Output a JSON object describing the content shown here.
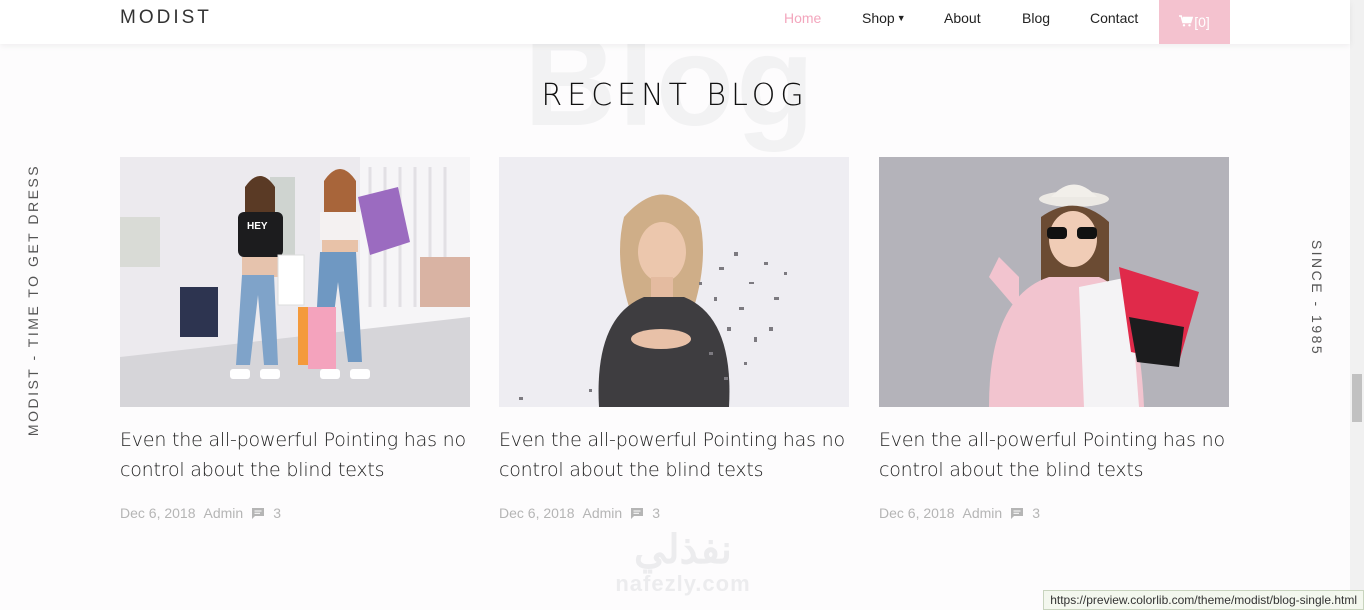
{
  "brand": "MODIST",
  "nav": {
    "home": "Home",
    "shop": "Shop",
    "about": "About",
    "blog": "Blog",
    "contact": "Contact",
    "cart": "[0]"
  },
  "section": {
    "bg_word": "Blog",
    "title": "RECENT BLOG"
  },
  "side": {
    "left": "MODIST - TIME TO GET DRESS",
    "right": "SINCE - 1985"
  },
  "posts": [
    {
      "title": "Even the all-powerful Pointing has no control about the blind texts",
      "date": "Dec 6, 2018",
      "author": "Admin",
      "comments": "3"
    },
    {
      "title": "Even the all-powerful Pointing has no control about the blind texts",
      "date": "Dec 6, 2018",
      "author": "Admin",
      "comments": "3"
    },
    {
      "title": "Even the all-powerful Pointing has no control about the blind texts",
      "date": "Dec 6, 2018",
      "author": "Admin",
      "comments": "3"
    }
  ],
  "watermark": {
    "arabic": "نفذلي",
    "latin": "nafezly.com"
  },
  "status_url": "https://preview.colorlib.com/theme/modist/blog-single.html",
  "colors": {
    "accent": "#f3a6bd",
    "cart_bg": "#f4c2cf"
  }
}
